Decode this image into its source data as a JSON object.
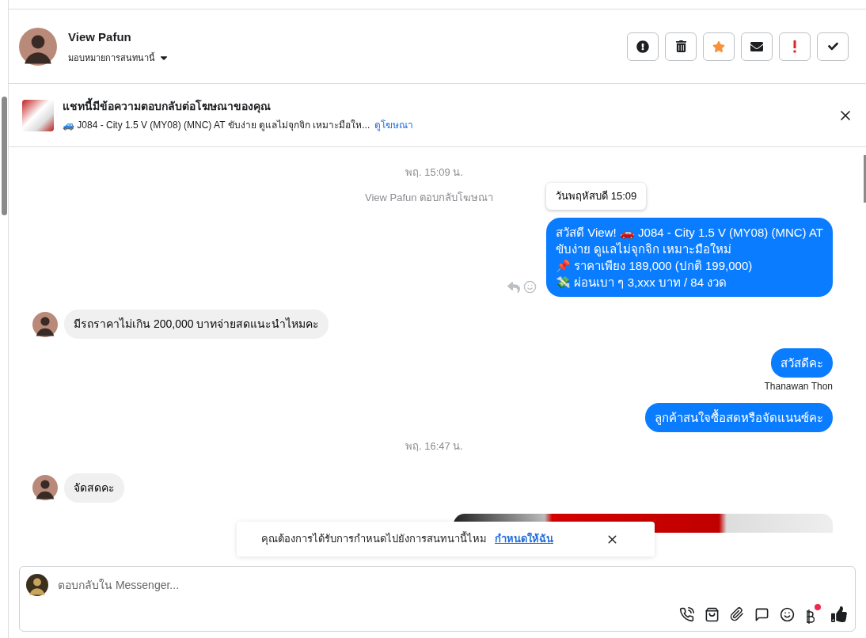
{
  "header": {
    "name": "View Pafun",
    "assign_label": "มอบหมายการสนทนานี้",
    "starred": true
  },
  "ad_banner": {
    "title": "แชทนี้มีข้อความตอบกลับต่อโฆษณาของคุณ",
    "description": "🚙 J084 - City 1.5 V (MY08) (MNC) AT ขับง่าย ดูแลไม่จุกจิก เหมาะมือให...",
    "link": "ดูโฆษณา"
  },
  "messages": [
    {
      "kind": "timestamp",
      "text": "พฤ. 15:09 น."
    },
    {
      "kind": "notice",
      "text": "View Pafun ตอบกลับโฆษณา"
    },
    {
      "kind": "outgoing",
      "tooltip": "วันพฤหัสบดี 15:09",
      "lines": [
        "สวัสดี View! 🚗 J084 - City 1.5 V (MY08) (MNC) AT",
        "ขับง่าย ดูแลไม่จุกจิก เหมาะมือใหม่",
        "📌 ราคาเพียง 189,000 (ปกติ 199,000)",
        "💸 ผ่อนเบา ๆ 3,xxx บาท / 84 งวด"
      ]
    },
    {
      "kind": "incoming",
      "lines": [
        "มีรถราคาไม่เกิน 200,000 บาทจ่ายสดแนะนำไหมคะ"
      ]
    },
    {
      "kind": "outgoing",
      "lines": [
        "สวัสดีคะ"
      ]
    },
    {
      "kind": "sender",
      "text": "Thanawan Thon"
    },
    {
      "kind": "outgoing",
      "lines": [
        "ลูกค้าสนใจซื้อสดหรือจัดแนนซ์คะ"
      ]
    },
    {
      "kind": "timestamp",
      "text": "พฤ. 16:47 น."
    },
    {
      "kind": "incoming",
      "lines": [
        "จัดสดคะ"
      ]
    },
    {
      "kind": "image"
    }
  ],
  "reminder": {
    "text": "คุณต้องการได้รับการกำหนดไปยังการสนทนานี้ไหม",
    "link": "กำหนดให้ฉัน"
  },
  "composer": {
    "placeholder": "ตอบกลับใน Messenger...",
    "payment_badge": true
  }
}
